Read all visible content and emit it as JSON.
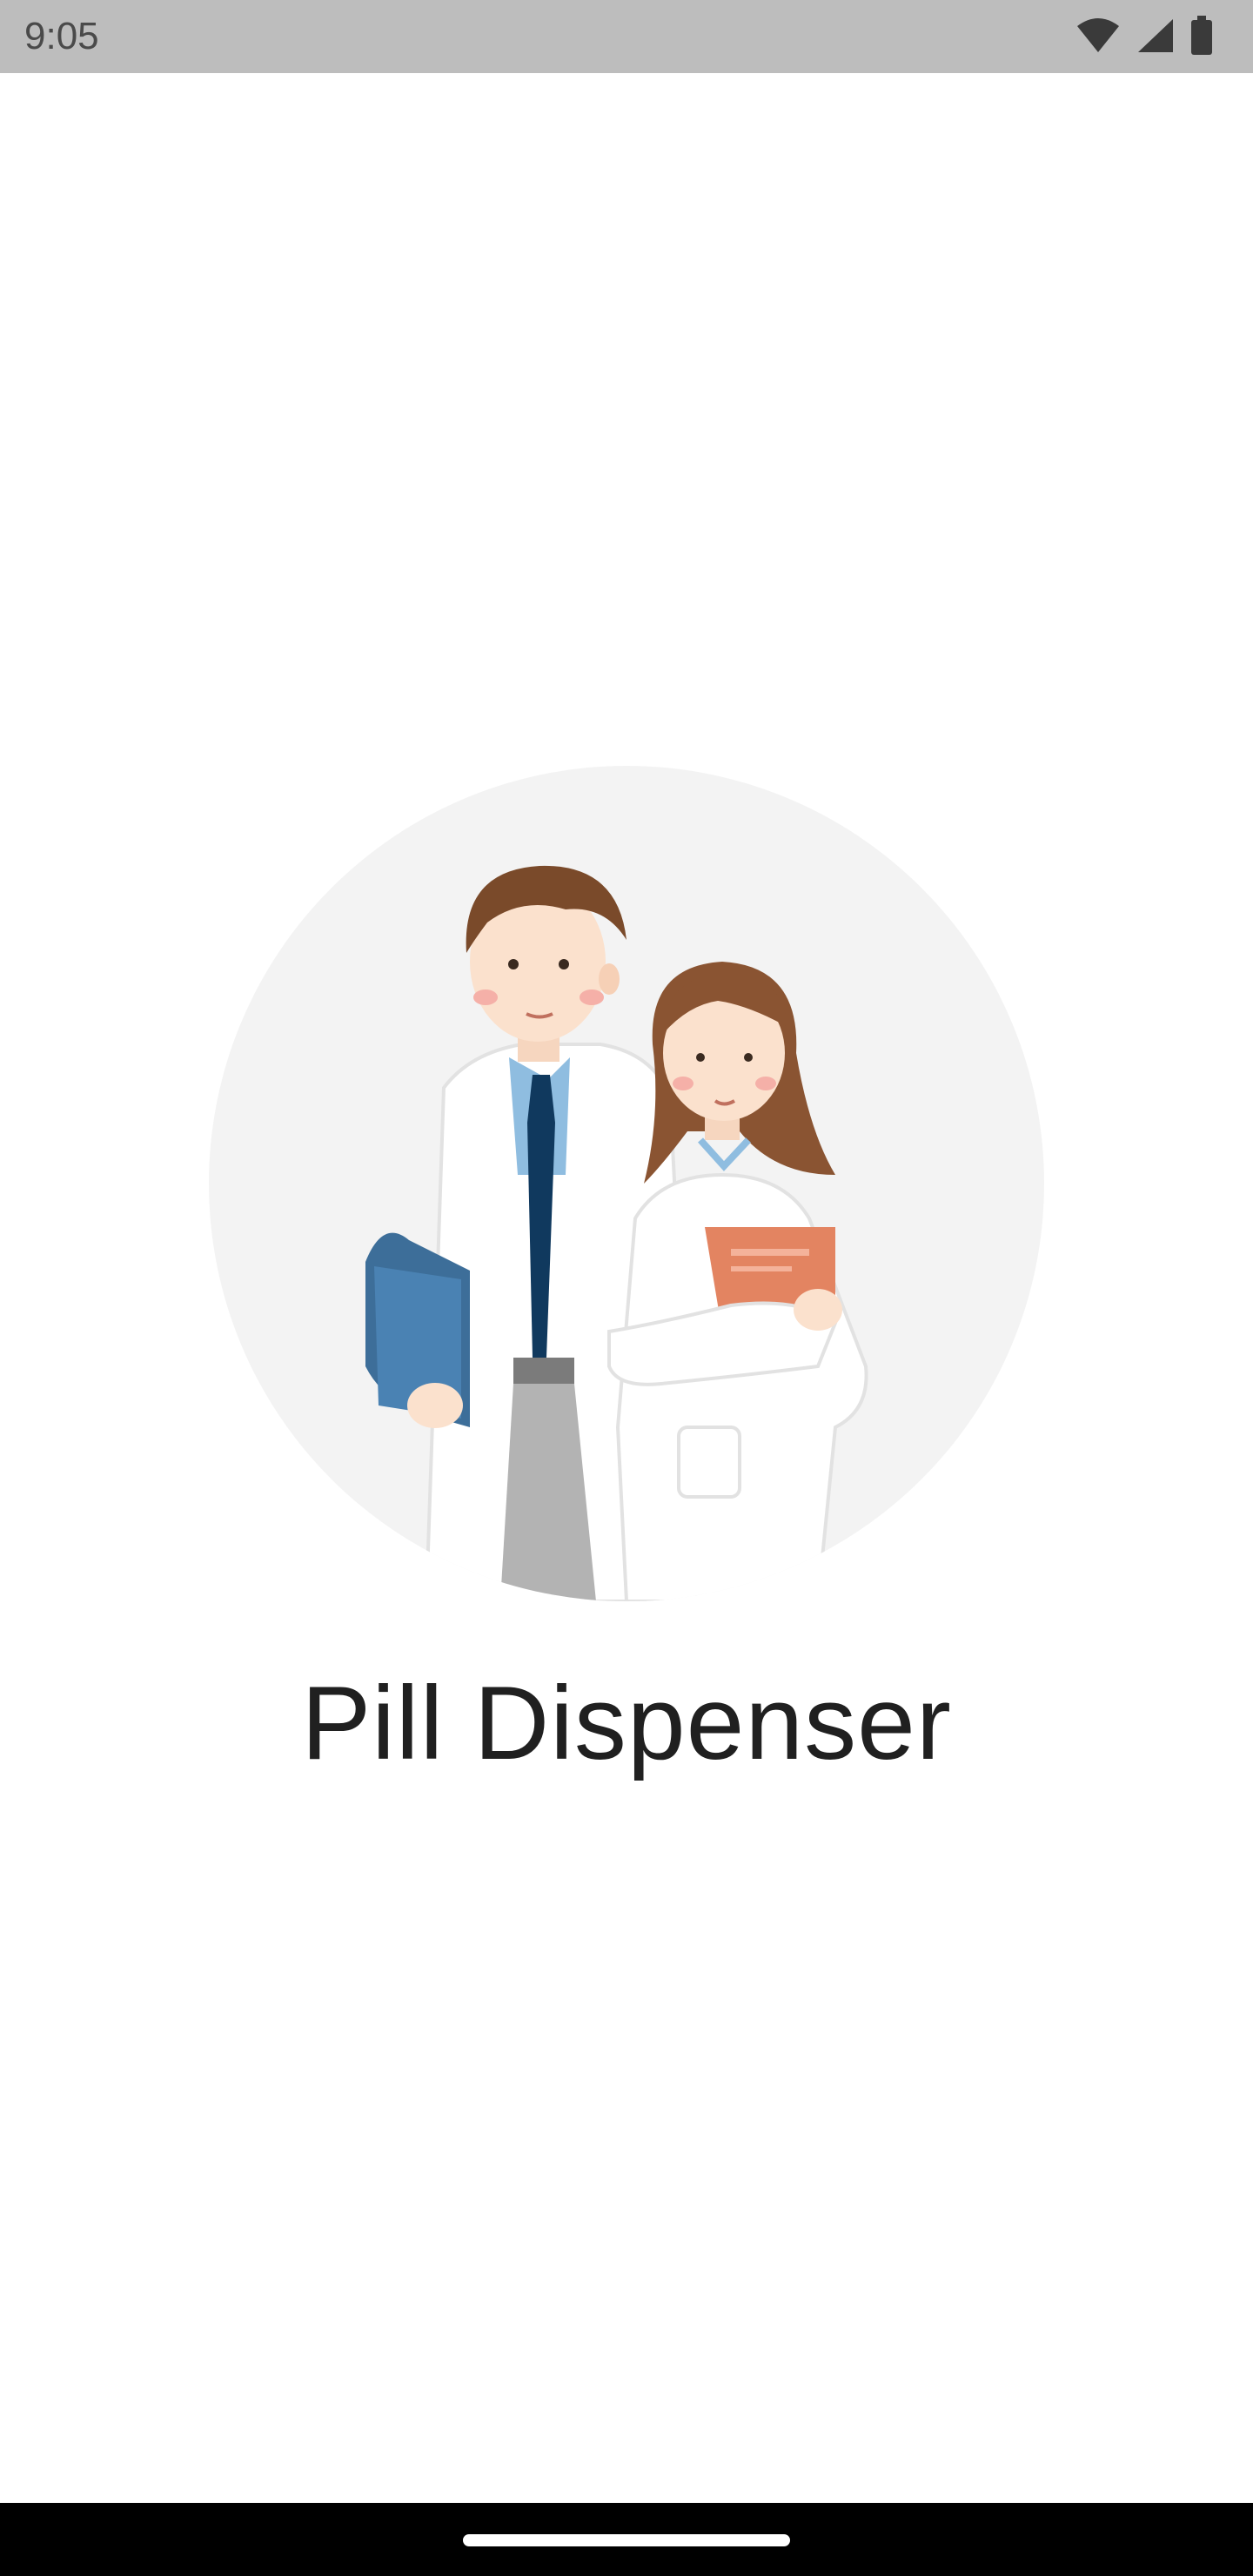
{
  "status_bar": {
    "time": "9:05",
    "icons": [
      "wifi-icon",
      "cellular-signal-icon",
      "battery-icon"
    ]
  },
  "splash": {
    "illustration": "doctors-illustration",
    "app_title": "Pill Dispenser"
  },
  "nav_bar": {
    "handle": "home-handle"
  },
  "colors": {
    "status_bar_bg": "#bdbdbd",
    "background": "#ffffff",
    "circle_bg": "#f3f3f3",
    "title_text": "#202020",
    "nav_bar_bg": "#000000"
  }
}
